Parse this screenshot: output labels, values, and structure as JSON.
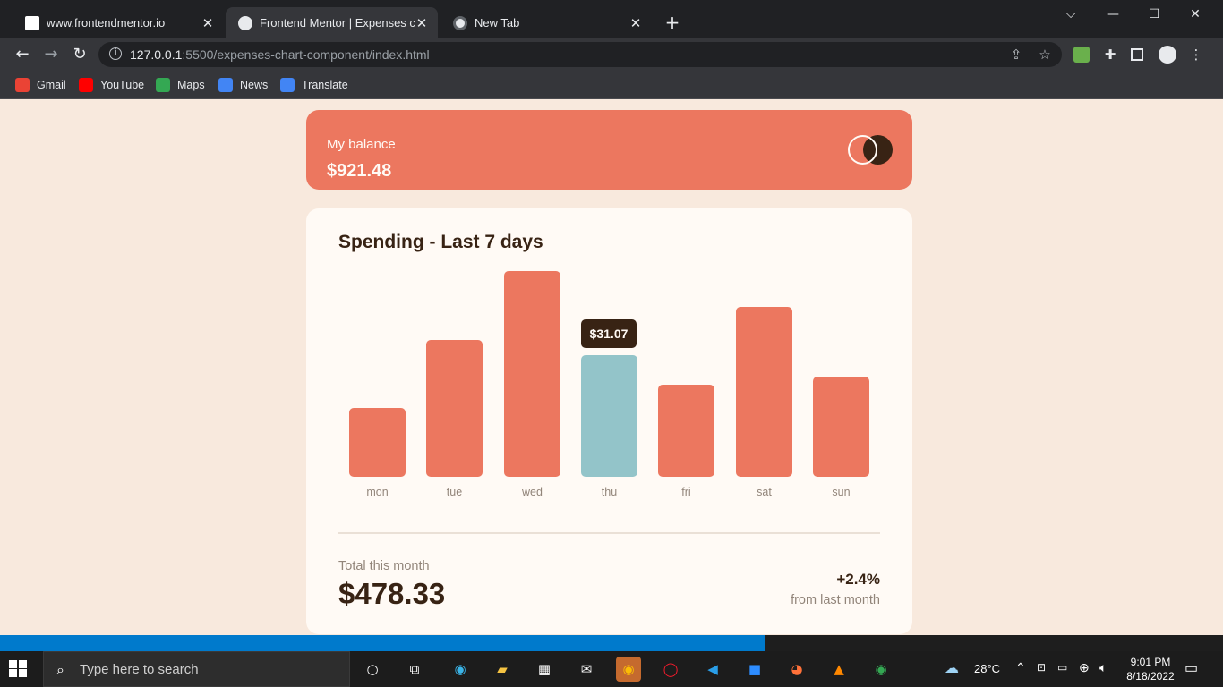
{
  "browser": {
    "tabs": [
      {
        "title": "www.frontendmentor.io",
        "active": false,
        "favicon_color": "#ffffff"
      },
      {
        "title": "Frontend Mentor | Expenses char",
        "active": true,
        "favicon_color": "#e8eaed"
      },
      {
        "title": "New Tab",
        "active": false,
        "favicon_color": "#e8eaed"
      }
    ],
    "new_tab_label": "+",
    "window_controls": {
      "dropdown": "⌵",
      "minimize": "—",
      "maximize": "☐",
      "close": "✕"
    },
    "url_host": "127.0.0.1",
    "url_rest": ":5500/expenses-chart-component/index.html",
    "bookmarks": [
      {
        "label": "Gmail",
        "icon": "gmail-icon",
        "color": "#ea4335"
      },
      {
        "label": "YouTube",
        "icon": "youtube-icon",
        "color": "#ff0000"
      },
      {
        "label": "Maps",
        "icon": "maps-icon",
        "color": "#34a853"
      },
      {
        "label": "News",
        "icon": "news-icon",
        "color": "#4285f4"
      },
      {
        "label": "Translate",
        "icon": "translate-icon",
        "color": "#4285f4"
      }
    ]
  },
  "balance": {
    "label": "My balance",
    "amount": "$921.48"
  },
  "spending": {
    "title": "Spending - Last 7 days",
    "tooltip": "$31.07",
    "total_label": "Total this month",
    "total_amount": "$478.33",
    "change_value": "+2.4%",
    "change_label": "from last month"
  },
  "chart_data": {
    "type": "bar",
    "categories": [
      "mon",
      "tue",
      "wed",
      "thu",
      "fri",
      "sat",
      "sun"
    ],
    "values": [
      17.45,
      34.91,
      52.36,
      31.07,
      23.39,
      43.28,
      25.48
    ],
    "highlight_index": 3,
    "colors": {
      "bar": "#ec775f",
      "highlight": "#93c4c9"
    }
  },
  "taskbar": {
    "search_placeholder": "Type here to search",
    "weather": "28°C",
    "time": "9:01 PM",
    "date": "8/18/2022"
  },
  "colors": {
    "page_bg": "#f8e9dd",
    "card_bg": "#fffaf5",
    "accent": "#ec775f",
    "dark_brown": "#382314",
    "cyan": "#93c4c9"
  }
}
